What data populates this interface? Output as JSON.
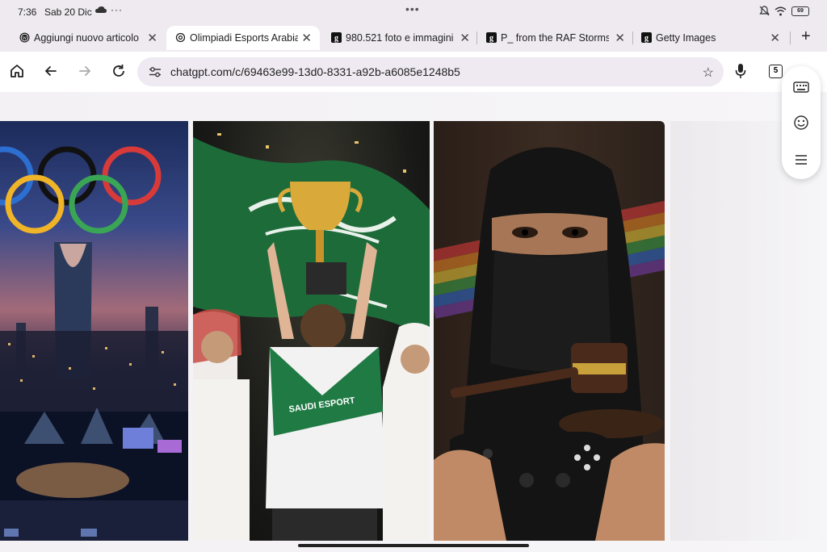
{
  "status_bar": {
    "time": "7:36",
    "date": "Sab 20 Dic",
    "battery": "69"
  },
  "tabs": [
    {
      "title": "Aggiungi nuovo articolo",
      "favicon": "wordpress-icon",
      "active": false
    },
    {
      "title": "Olimpiadi Esports Arabia",
      "favicon": "openai-icon",
      "active": true
    },
    {
      "title": "980.521 foto e immagini",
      "favicon": "getty-icon",
      "active": false
    },
    {
      "title": "P_ from the RAF Stormsh",
      "favicon": "getty-icon",
      "active": false
    },
    {
      "title": "Getty Images",
      "favicon": "getty-icon",
      "active": false
    }
  ],
  "toolbar": {
    "url": "chatgpt.com/c/69463e99-13d0-8331-a92b-a6085e1248b5",
    "tab_count": "5"
  },
  "images": [
    {
      "name": "riyadh-olympic-rings-skyline-image"
    },
    {
      "name": "saudi-flag-esports-trophy-image"
    },
    {
      "name": "niqab-gamepad-gavel-image"
    }
  ],
  "floating_panel": {
    "icons": [
      "keyboard-icon",
      "emoji-icon",
      "menu-icon"
    ]
  },
  "colors": {
    "chrome_bg": "#eeeaf0",
    "omnibox_bg": "#efeaf2",
    "accent_green": "#1e6b3a"
  }
}
